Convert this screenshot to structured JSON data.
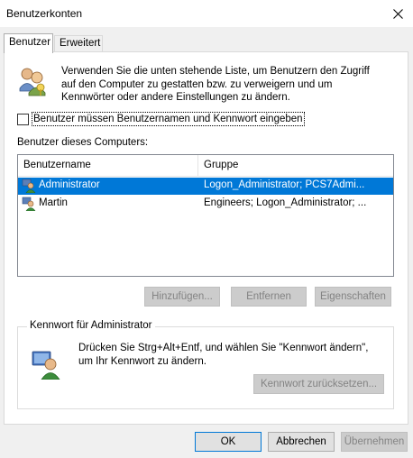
{
  "window": {
    "title": "Benutzerkonten",
    "close_glyph": "✕"
  },
  "tabs": [
    {
      "label": "Benutzer",
      "active": true
    },
    {
      "label": "Erweitert",
      "active": false
    }
  ],
  "intro": {
    "text": "Verwenden Sie die unten stehende Liste, um Benutzern den Zugriff auf den Computer zu gestatten bzw. zu verweigern und um Kennwörter oder andere Einstellungen zu ändern.",
    "icon": "users-icon"
  },
  "require_login": {
    "label": "Benutzer müssen Benutzernamen und Kennwort eingeben",
    "checked": false
  },
  "users_list": {
    "label": "Benutzer dieses Computers:",
    "columns": [
      "Benutzername",
      "Gruppe"
    ],
    "rows": [
      {
        "name": "Administrator",
        "group": "Logon_Administrator; PCS7Admi...",
        "selected": true
      },
      {
        "name": "Martin",
        "group": "Engineers; Logon_Administrator; ...",
        "selected": false
      }
    ]
  },
  "list_buttons": {
    "add": "Hinzufügen...",
    "remove": "Entfernen",
    "properties": "Eigenschaften"
  },
  "password_group": {
    "title": "Kennwort für Administrator",
    "text": "Drücken Sie Strg+Alt+Entf, und wählen Sie \"Kennwort ändern\", um Ihr Kennwort zu ändern.",
    "reset_button": "Kennwort zurücksetzen..."
  },
  "dialog_buttons": {
    "ok": "OK",
    "cancel": "Abbrechen",
    "apply": "Übernehmen"
  },
  "colors": {
    "selection": "#0078d7",
    "disabled_text": "#838383"
  }
}
